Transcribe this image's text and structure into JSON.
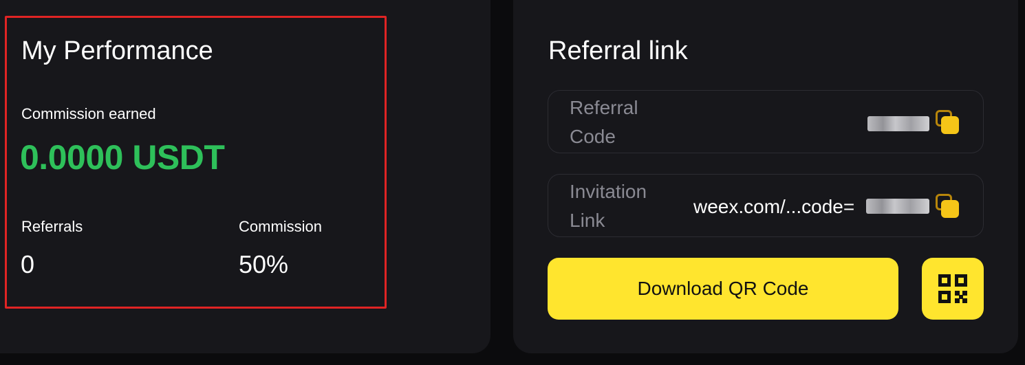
{
  "performance": {
    "title": "My Performance",
    "commission_earned_label": "Commission earned",
    "commission_earned_value": "0.0000 USDT",
    "referrals_label": "Referrals",
    "referrals_value": "0",
    "commission_label": "Commission",
    "commission_value": "50%"
  },
  "referral": {
    "title": "Referral link",
    "code_label": "Referral Code",
    "invitation_label": "Invitation Link",
    "invitation_value": "weex.com/...code=",
    "download_button": "Download QR Code"
  },
  "colors": {
    "background": "#0b0b0d",
    "card": "#17171b",
    "accent_green": "#2ec05a",
    "accent_yellow": "#ffe52e",
    "highlight_border": "#e02424"
  },
  "icons": {
    "copy": "copy-icon",
    "qr": "qr-code-icon"
  }
}
